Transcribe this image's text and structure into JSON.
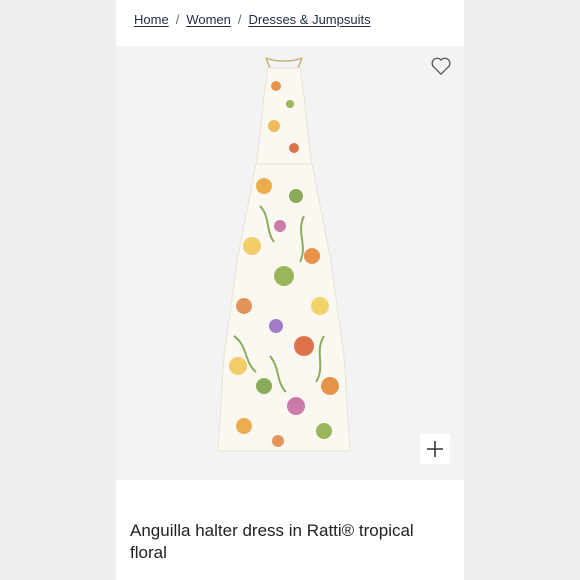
{
  "breadcrumb": {
    "home": "Home",
    "women": "Women",
    "category": "Dresses & Jumpsuits",
    "separator": "/"
  },
  "product": {
    "title": "Anguilla halter dress in Ratti® tropical floral",
    "image_alt": "Floral halter maxi dress"
  },
  "icons": {
    "favorite": "heart-icon",
    "quick_add": "plus-icon"
  },
  "colors": {
    "text": "#1f2a44",
    "image_bg": "#f3f3f3"
  }
}
